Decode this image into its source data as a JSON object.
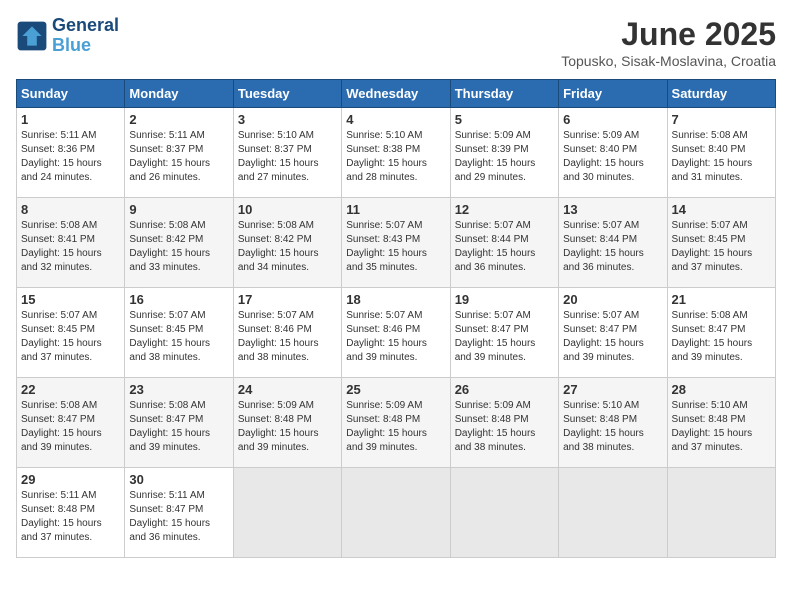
{
  "logo": {
    "line1": "General",
    "line2": "Blue"
  },
  "title": "June 2025",
  "subtitle": "Topusko, Sisak-Moslavina, Croatia",
  "days_of_week": [
    "Sunday",
    "Monday",
    "Tuesday",
    "Wednesday",
    "Thursday",
    "Friday",
    "Saturday"
  ],
  "weeks": [
    [
      {
        "day": "1",
        "sunrise": "5:11 AM",
        "sunset": "8:36 PM",
        "daylight": "15 hours and 24 minutes."
      },
      {
        "day": "2",
        "sunrise": "5:11 AM",
        "sunset": "8:37 PM",
        "daylight": "15 hours and 26 minutes."
      },
      {
        "day": "3",
        "sunrise": "5:10 AM",
        "sunset": "8:37 PM",
        "daylight": "15 hours and 27 minutes."
      },
      {
        "day": "4",
        "sunrise": "5:10 AM",
        "sunset": "8:38 PM",
        "daylight": "15 hours and 28 minutes."
      },
      {
        "day": "5",
        "sunrise": "5:09 AM",
        "sunset": "8:39 PM",
        "daylight": "15 hours and 29 minutes."
      },
      {
        "day": "6",
        "sunrise": "5:09 AM",
        "sunset": "8:40 PM",
        "daylight": "15 hours and 30 minutes."
      },
      {
        "day": "7",
        "sunrise": "5:08 AM",
        "sunset": "8:40 PM",
        "daylight": "15 hours and 31 minutes."
      }
    ],
    [
      {
        "day": "8",
        "sunrise": "5:08 AM",
        "sunset": "8:41 PM",
        "daylight": "15 hours and 32 minutes."
      },
      {
        "day": "9",
        "sunrise": "5:08 AM",
        "sunset": "8:42 PM",
        "daylight": "15 hours and 33 minutes."
      },
      {
        "day": "10",
        "sunrise": "5:08 AM",
        "sunset": "8:42 PM",
        "daylight": "15 hours and 34 minutes."
      },
      {
        "day": "11",
        "sunrise": "5:07 AM",
        "sunset": "8:43 PM",
        "daylight": "15 hours and 35 minutes."
      },
      {
        "day": "12",
        "sunrise": "5:07 AM",
        "sunset": "8:44 PM",
        "daylight": "15 hours and 36 minutes."
      },
      {
        "day": "13",
        "sunrise": "5:07 AM",
        "sunset": "8:44 PM",
        "daylight": "15 hours and 36 minutes."
      },
      {
        "day": "14",
        "sunrise": "5:07 AM",
        "sunset": "8:45 PM",
        "daylight": "15 hours and 37 minutes."
      }
    ],
    [
      {
        "day": "15",
        "sunrise": "5:07 AM",
        "sunset": "8:45 PM",
        "daylight": "15 hours and 37 minutes."
      },
      {
        "day": "16",
        "sunrise": "5:07 AM",
        "sunset": "8:45 PM",
        "daylight": "15 hours and 38 minutes."
      },
      {
        "day": "17",
        "sunrise": "5:07 AM",
        "sunset": "8:46 PM",
        "daylight": "15 hours and 38 minutes."
      },
      {
        "day": "18",
        "sunrise": "5:07 AM",
        "sunset": "8:46 PM",
        "daylight": "15 hours and 39 minutes."
      },
      {
        "day": "19",
        "sunrise": "5:07 AM",
        "sunset": "8:47 PM",
        "daylight": "15 hours and 39 minutes."
      },
      {
        "day": "20",
        "sunrise": "5:07 AM",
        "sunset": "8:47 PM",
        "daylight": "15 hours and 39 minutes."
      },
      {
        "day": "21",
        "sunrise": "5:08 AM",
        "sunset": "8:47 PM",
        "daylight": "15 hours and 39 minutes."
      }
    ],
    [
      {
        "day": "22",
        "sunrise": "5:08 AM",
        "sunset": "8:47 PM",
        "daylight": "15 hours and 39 minutes."
      },
      {
        "day": "23",
        "sunrise": "5:08 AM",
        "sunset": "8:47 PM",
        "daylight": "15 hours and 39 minutes."
      },
      {
        "day": "24",
        "sunrise": "5:09 AM",
        "sunset": "8:48 PM",
        "daylight": "15 hours and 39 minutes."
      },
      {
        "day": "25",
        "sunrise": "5:09 AM",
        "sunset": "8:48 PM",
        "daylight": "15 hours and 39 minutes."
      },
      {
        "day": "26",
        "sunrise": "5:09 AM",
        "sunset": "8:48 PM",
        "daylight": "15 hours and 38 minutes."
      },
      {
        "day": "27",
        "sunrise": "5:10 AM",
        "sunset": "8:48 PM",
        "daylight": "15 hours and 38 minutes."
      },
      {
        "day": "28",
        "sunrise": "5:10 AM",
        "sunset": "8:48 PM",
        "daylight": "15 hours and 37 minutes."
      }
    ],
    [
      {
        "day": "29",
        "sunrise": "5:11 AM",
        "sunset": "8:48 PM",
        "daylight": "15 hours and 37 minutes."
      },
      {
        "day": "30",
        "sunrise": "5:11 AM",
        "sunset": "8:47 PM",
        "daylight": "15 hours and 36 minutes."
      },
      null,
      null,
      null,
      null,
      null
    ]
  ]
}
